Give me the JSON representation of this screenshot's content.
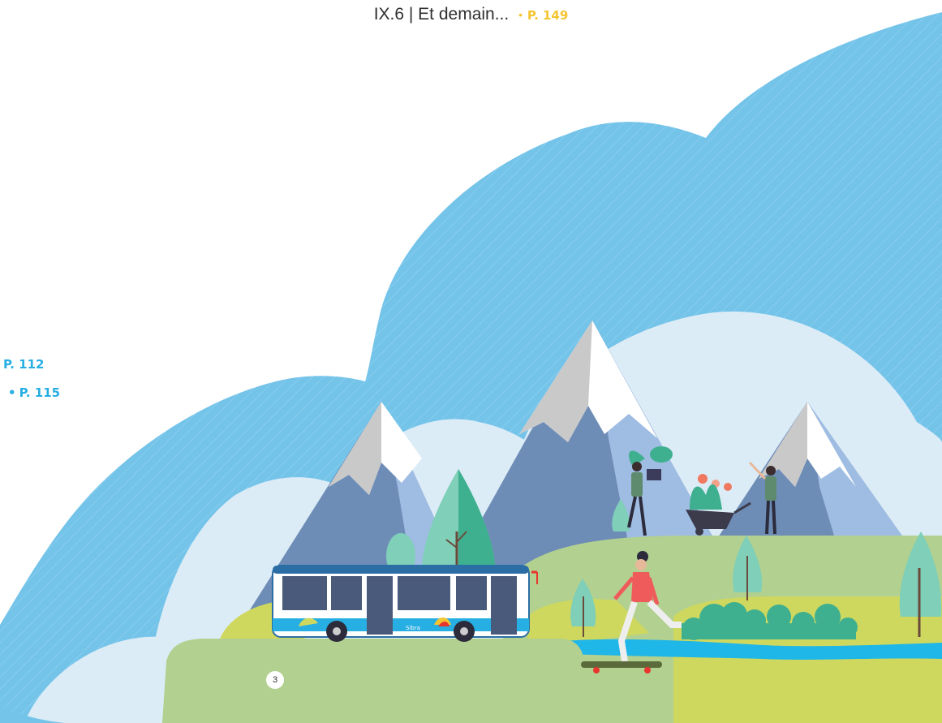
{
  "header": {
    "title": "IX.6 | Et demain...",
    "page_ref": "P. 149",
    "bullet": "•"
  },
  "left_refs": [
    {
      "text": "P. 112",
      "bullet": ""
    },
    {
      "text": "P. 115",
      "bullet": "•"
    }
  ],
  "badge": {
    "number": "3"
  },
  "bus": {
    "logo_text": "Sibra"
  },
  "colors": {
    "sky_blue": "#74c3e9",
    "cloud_light": "#dcecf7",
    "mountain_dark": "#6e8db6",
    "mountain_light": "#9fbde3",
    "snow": "#ffffff",
    "grass": "#b2d08f",
    "grass_yellow": "#cfd85e",
    "tree_green": "#3fb08f",
    "tree_light": "#7fcfb9",
    "water": "#1fb6e8",
    "accent_yellow": "#f4c531",
    "accent_blue": "#27aee3"
  }
}
